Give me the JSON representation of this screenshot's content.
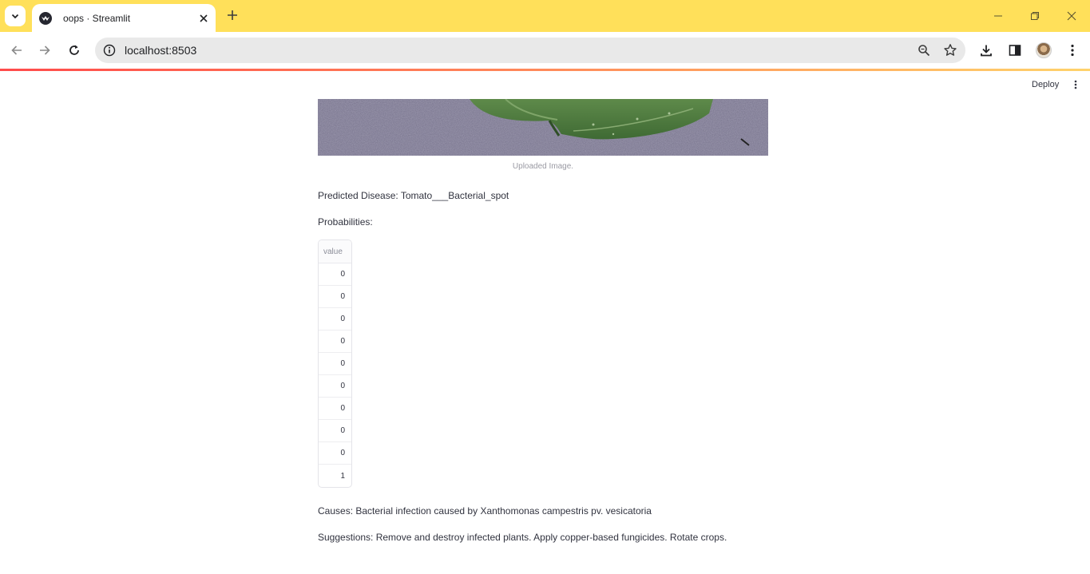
{
  "browser": {
    "tab_title": "oops · Streamlit",
    "url": "localhost:8503"
  },
  "app": {
    "deploy_label": "Deploy",
    "image_caption": "Uploaded Image.",
    "predicted_text": "Predicted Disease: Tomato___Bacterial_spot",
    "probabilities_label": "Probabilities:",
    "table": {
      "header": "value",
      "rows": [
        "0",
        "0",
        "0",
        "0",
        "0",
        "0",
        "0",
        "0",
        "0",
        "1"
      ]
    },
    "causes_text": "Causes: Bacterial infection caused by Xanthomonas campestris pv. vesicatoria",
    "suggestions_text": "Suggestions: Remove and destroy infected plants. Apply copper-based fungicides. Rotate crops."
  },
  "colors": {
    "tabstrip": "#ffe05a",
    "omnibox": "#e9e9e9",
    "text": "#31333f",
    "progress_start": "#ff4b4b",
    "progress_end": "#ffd36b"
  }
}
